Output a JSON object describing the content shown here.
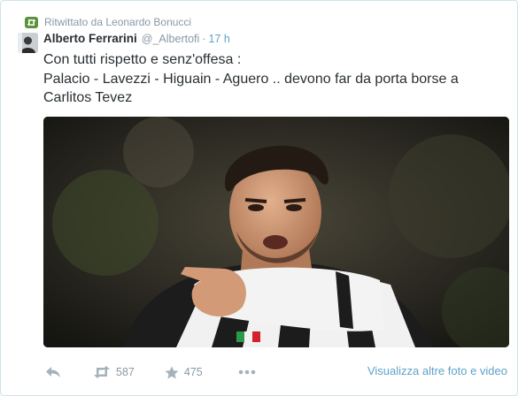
{
  "retweet": {
    "label": "Ritwittato da Leonardo Bonucci",
    "icon": "retweet-icon"
  },
  "tweet": {
    "author_name": "Alberto Ferrarini",
    "author_handle": "@_Albertofi",
    "separator": "·",
    "time": "17 h",
    "text_lines": [
      "Con tutti rispetto e senz'offesa :",
      "Palacio - Lavezzi - Higuain - Aguero .. devono far da porta borse a",
      "Carlitos Tevez"
    ]
  },
  "actions": {
    "reply_icon": "reply-icon",
    "retweet_icon": "retweet-icon",
    "retweet_count": "587",
    "favorite_icon": "star-icon",
    "favorite_count": "475",
    "more_icon": "more-dots-icon",
    "more_media_link": "Visualizza altre foto e video"
  },
  "colors": {
    "accent": "#5fa2c8",
    "retweet_green": "#5c913b",
    "muted": "#8899a6",
    "text": "#292f33",
    "card_border": "#cfe3ea"
  }
}
